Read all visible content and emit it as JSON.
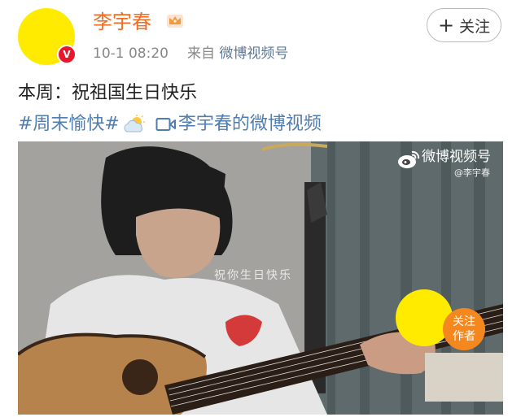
{
  "header": {
    "username": "李宇春",
    "verified_badge": "V",
    "time": "10-1 08:20",
    "source_prefix": "来自",
    "source_name": "微博视频号",
    "follow_label": "关注",
    "follow_icon": "+"
  },
  "post": {
    "text": "本周：祝祖国生日快乐",
    "hashtag": "#周末愉快#",
    "weather_icon": "sun-behind-cloud-icon",
    "video_link_text": "李宇春的微博视频"
  },
  "video": {
    "watermark_title": "微博视频号",
    "watermark_user": "@李宇春",
    "subtitle": "祝你生日快乐",
    "follow_author_label": [
      "关注",
      "作者"
    ]
  },
  "colors": {
    "username": "#f26c22",
    "link": "#507daf",
    "verified": "#e6162d",
    "follow_author": "#f5871f",
    "avatar": "#ffeb00"
  }
}
